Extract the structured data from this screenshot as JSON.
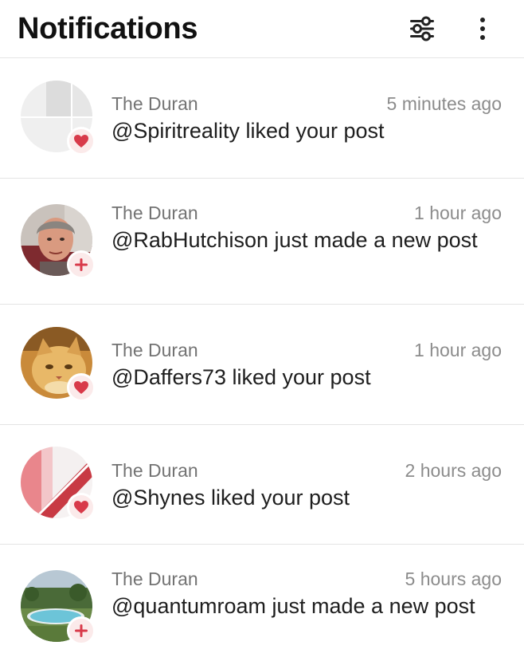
{
  "header": {
    "title": "Notifications",
    "filter_icon": "sliders-icon",
    "menu_icon": "more-vertical-icon"
  },
  "colors": {
    "badge_bg": "#fbeaea",
    "badge_icon": "#d83a4a",
    "divider": "#e4e4e4"
  },
  "notifications": [
    {
      "source": "The Duran",
      "time": "5 minutes ago",
      "message": "@Spiritreality liked your post",
      "type": "like",
      "badge_icon": "heart-icon"
    },
    {
      "source": "The Duran",
      "time": "1 hour ago",
      "message": "@RabHutchison just made a new post",
      "type": "new-post",
      "badge_icon": "plus-icon"
    },
    {
      "source": "The Duran",
      "time": "1 hour ago",
      "message": "@Daffers73 liked your post",
      "type": "like",
      "badge_icon": "heart-icon"
    },
    {
      "source": "The Duran",
      "time": "2 hours ago",
      "message": "@Shynes liked your post",
      "type": "like",
      "badge_icon": "heart-icon"
    },
    {
      "source": "The Duran",
      "time": "5 hours ago",
      "message": "@quantumroam just made a new post",
      "type": "new-post",
      "badge_icon": "plus-icon"
    }
  ]
}
